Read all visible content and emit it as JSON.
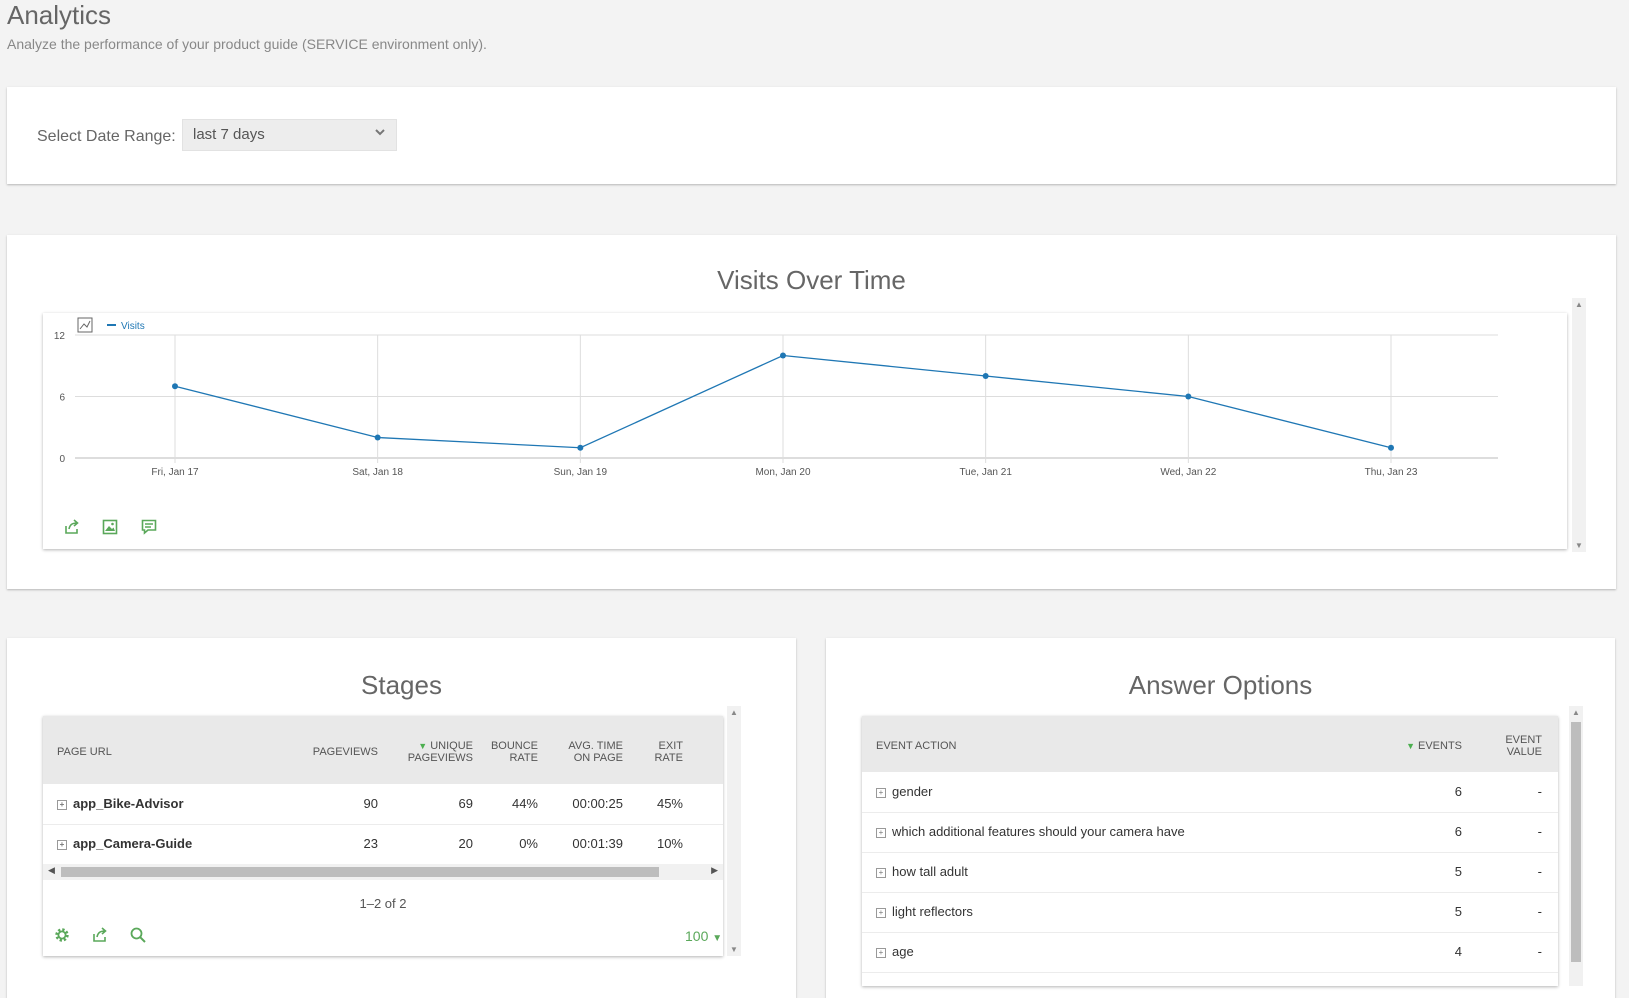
{
  "header": {
    "title": "Analytics",
    "subtitle": "Analyze the performance of your product guide (SERVICE environment only)."
  },
  "date_range": {
    "label": "Select Date Range:",
    "value": "last 7 days"
  },
  "visits": {
    "title": "Visits Over Time"
  },
  "chart_data": {
    "type": "line",
    "categories": [
      "Fri, Jan 17",
      "Sat, Jan 18",
      "Sun, Jan 19",
      "Mon, Jan 20",
      "Tue, Jan 21",
      "Wed, Jan 22",
      "Thu, Jan 23"
    ],
    "series": [
      {
        "name": "Visits",
        "values": [
          7,
          2,
          1,
          10,
          8,
          6,
          1
        ]
      }
    ],
    "yticks": [
      "0",
      "6",
      "12"
    ],
    "ylim": [
      0,
      12
    ],
    "grid": true,
    "legend": "top-left",
    "color": "#1f77b4"
  },
  "stages": {
    "title": "Stages",
    "columns": [
      {
        "key": "url",
        "label": [
          "PAGE URL"
        ]
      },
      {
        "key": "pageviews",
        "label": [
          "PAGEVIEWS"
        ]
      },
      {
        "key": "unique",
        "label": [
          "UNIQUE",
          "PAGEVIEWS"
        ],
        "sorted": true
      },
      {
        "key": "bounce",
        "label": [
          "BOUNCE",
          "RATE"
        ]
      },
      {
        "key": "time",
        "label": [
          "AVG. TIME",
          "ON PAGE"
        ]
      },
      {
        "key": "exit",
        "label": [
          "EXIT",
          "RATE"
        ]
      }
    ],
    "rows": [
      {
        "url": "app_Bike-Advisor",
        "pageviews": "90",
        "unique": "69",
        "bounce": "44%",
        "time": "00:00:25",
        "exit": "45%"
      },
      {
        "url": "app_Camera-Guide",
        "pageviews": "23",
        "unique": "20",
        "bounce": "0%",
        "time": "00:01:39",
        "exit": "10%"
      }
    ],
    "pagination": "1–2 of 2",
    "limit": "100"
  },
  "answers": {
    "title": "Answer Options",
    "columns": [
      {
        "key": "action",
        "label": [
          "EVENT ACTION"
        ]
      },
      {
        "key": "events",
        "label": [
          "EVENTS"
        ],
        "sorted": true
      },
      {
        "key": "value",
        "label": [
          "EVENT",
          "VALUE"
        ]
      }
    ],
    "rows": [
      {
        "action": "gender",
        "events": "6",
        "value": "-"
      },
      {
        "action": "which additional features should your camera have",
        "events": "6",
        "value": "-"
      },
      {
        "action": "how tall adult",
        "events": "5",
        "value": "-"
      },
      {
        "action": "light reflectors",
        "events": "5",
        "value": "-"
      },
      {
        "action": "age",
        "events": "4",
        "value": "-"
      }
    ]
  },
  "icons": {
    "chart_type": "line-chart-icon",
    "export": "export-icon",
    "image": "image-icon",
    "annotation": "annotation-icon",
    "settings": "gear-icon",
    "search": "search-icon",
    "expand": "expand-icon"
  },
  "colors": {
    "accent": "#5aa85a",
    "line": "#1f77b4",
    "header_bg": "#e9e9e9"
  }
}
